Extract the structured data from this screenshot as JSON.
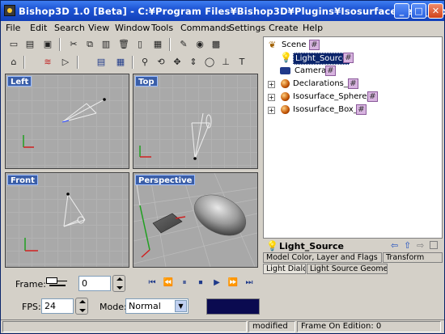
{
  "window": {
    "title": "Bishop3D 1.0 [Beta] - C:¥Program Files¥Bishop3D¥Plugins¥Isosurface_test_A_bsp",
    "min": "_",
    "max": "□",
    "close": "✕"
  },
  "menu": [
    "File",
    "Edit",
    "Search",
    "View",
    "Window",
    "Tools",
    "Commands",
    "Settings",
    "Create",
    "Help"
  ],
  "viewports": {
    "left": "Left",
    "top": "Top",
    "front": "Front",
    "perspective": "Perspective"
  },
  "tree": {
    "root": "Scene",
    "items": [
      {
        "label": "Light_Source",
        "selected": true,
        "icon": "lightbulb-icon"
      },
      {
        "label": "Camera",
        "icon": "camera-icon"
      },
      {
        "label": "Declarations_",
        "icon": "sphere-icon"
      },
      {
        "label": "Isosurface_Sphere_",
        "icon": "sphere-icon"
      },
      {
        "label": "Isosurface_Box_",
        "icon": "sphere-icon"
      }
    ],
    "tag": "#"
  },
  "properties": {
    "title": "Light_Source",
    "tabs_row1": [
      "Model Color, Layer and Flags",
      "Transform"
    ],
    "tabs_row2": [
      "Light Dialog",
      "Light Source Geometry"
    ]
  },
  "controls": {
    "frame_label": "Frame:",
    "frame_value": "0",
    "fps_label": "FPS:",
    "fps_value": "24",
    "mode_label": "Mode:",
    "mode_value": "Normal"
  },
  "status": {
    "cell1": "",
    "modified": "modified",
    "frame_edition": "Frame On Edition: 0"
  },
  "colors": {
    "titlebar": "#1f56d6",
    "viewport_bg": "#a9a9a9",
    "viewport_label": "#3a5ea8",
    "selection": "#0a246a"
  }
}
